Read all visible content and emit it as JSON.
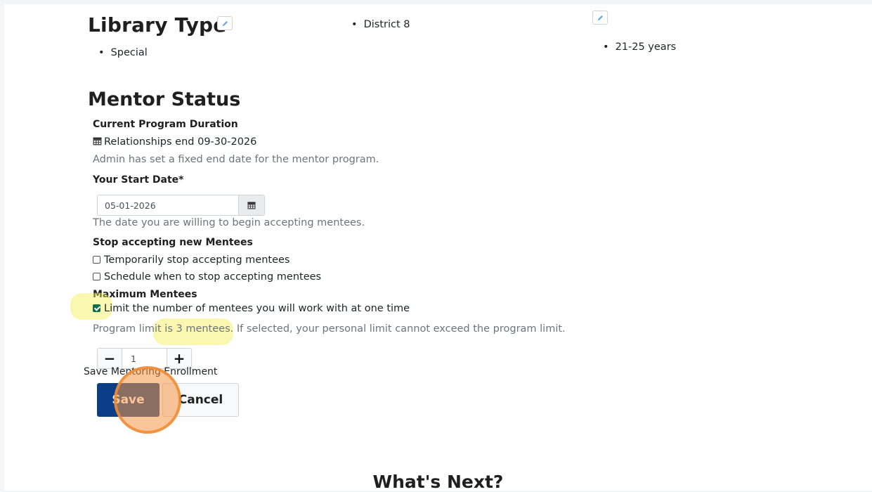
{
  "top": {
    "library_type_heading": "Library Type",
    "library_type_value": "Special",
    "district_value": "District 8",
    "age_range_value": "21-25 years"
  },
  "mentor_status": {
    "heading": "Mentor Status",
    "program_duration_label": "Current Program Duration",
    "relationships_end": "Relationships end 09-30-2026",
    "admin_note": "Admin has set a fixed end date for the mentor program.",
    "start_date_label": "Your Start Date*",
    "start_date_value": "05-01-2026",
    "start_date_help": "The date you are willing to begin accepting mentees.",
    "stop_label": "Stop accepting new Mentees",
    "temp_stop_label": "Temporarily stop accepting mentees",
    "schedule_stop_label": "Schedule when to stop accepting mentees",
    "max_label": "Maximum Mentees",
    "limit_label": "Limit the number of mentees you will work with at one time",
    "program_limit_text": "Program limit is 3 mentees. If selected, your personal limit cannot exceed the program limit.",
    "limit_value": "1",
    "stepper_minus": "−",
    "stepper_plus": "+"
  },
  "actions": {
    "form_caption": "Save Mentoring Enrollment",
    "save_label": "Save",
    "cancel_label": "Cancel"
  },
  "next_heading": "What's Next?",
  "icons": {
    "edit": "pencil-icon",
    "calendar": "calendar-icon"
  },
  "colors": {
    "primary": "#0b3e86",
    "highlight": "#f5f050",
    "click_marker": "#f59646"
  }
}
